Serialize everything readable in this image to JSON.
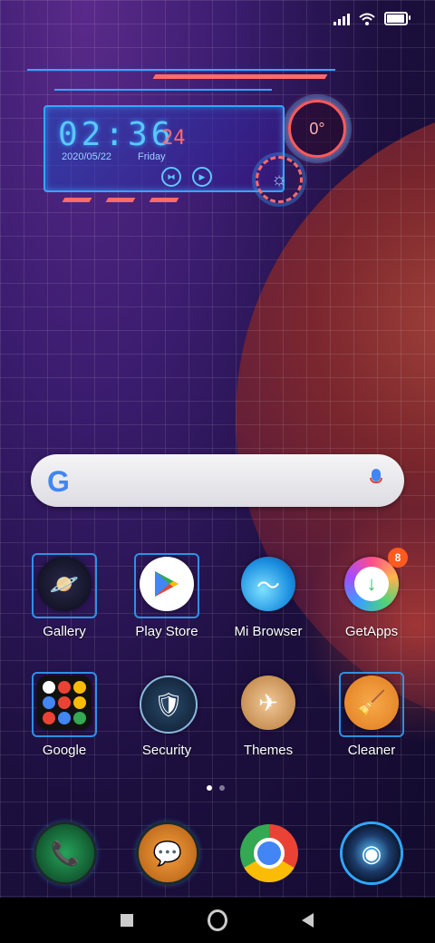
{
  "status_bar": {
    "signal_icon": "signal-icon",
    "wifi_icon": "wifi-icon",
    "battery_icon": "battery-icon",
    "battery_level": 0.85
  },
  "clock_widget": {
    "time": "02:36",
    "seconds": "24",
    "date": "2020/05/22",
    "weekday": "Friday",
    "temperature": "0°",
    "accent": "#33a7ff",
    "alert": "#ff6a6a"
  },
  "search": {
    "logo_text": "G",
    "mic_icon": "mic-icon"
  },
  "apps": [
    {
      "label": "Gallery",
      "icon": "planet-icon",
      "color": "#f0c16a"
    },
    {
      "label": "Play Store",
      "icon": "play-store-icon",
      "color": "#ffffff"
    },
    {
      "label": "Mi Browser",
      "icon": "wave-icon",
      "color": "#46b3f2"
    },
    {
      "label": "GetApps",
      "icon": "download-icon",
      "color": "#ffffff",
      "badge": "8"
    },
    {
      "label": "Google",
      "icon": "folder-icon",
      "color": "#111111"
    },
    {
      "label": "Security",
      "icon": "shield-icon",
      "color": "#1c3a5a"
    },
    {
      "label": "Themes",
      "icon": "airplane-icon",
      "color": "#c7894a"
    },
    {
      "label": "Cleaner",
      "icon": "broom-icon",
      "color": "#f0963a"
    }
  ],
  "page_indicator": {
    "pages": 2,
    "current": 1
  },
  "dock": [
    {
      "name": "Phone",
      "icon": "phone-icon",
      "color": "#1b6e3a"
    },
    {
      "name": "Messages",
      "icon": "chat-icon",
      "color": "#e08a2e"
    },
    {
      "name": "Chrome",
      "icon": "chrome-icon",
      "color": "#ffffff"
    },
    {
      "name": "Camera",
      "icon": "camera-icon",
      "color": "#1c3a6a"
    }
  ],
  "navigation": {
    "recents_icon": "recents-icon",
    "home_icon": "home-icon",
    "back_icon": "back-icon"
  }
}
